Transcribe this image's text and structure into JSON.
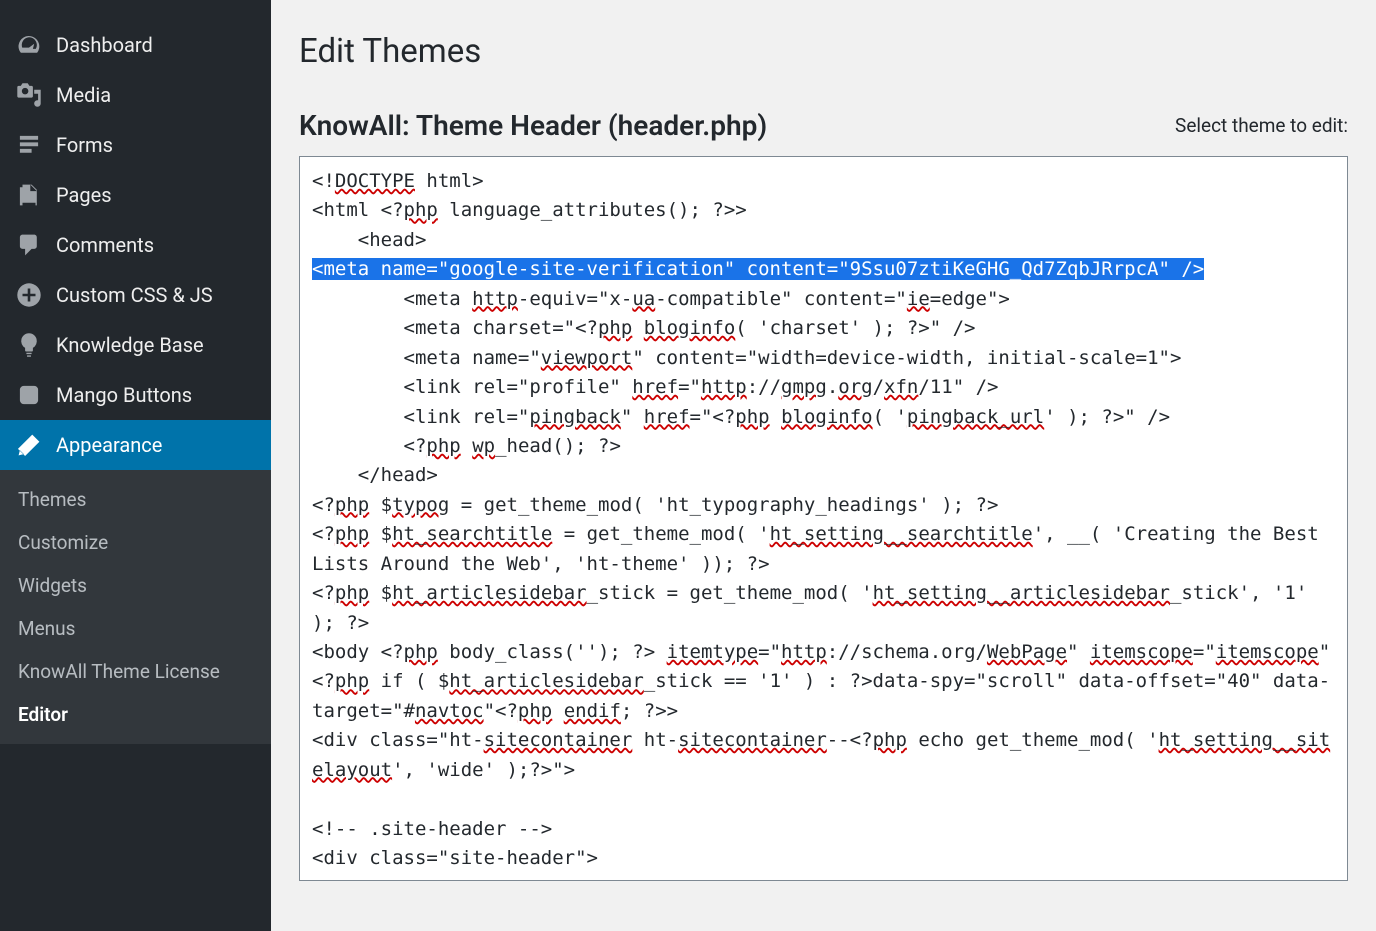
{
  "sidebar": [
    {
      "label": "Dashboard",
      "icon": "dashboard",
      "key": "dashboard"
    },
    {
      "label": "Media",
      "icon": "media",
      "key": "media"
    },
    {
      "label": "Forms",
      "icon": "forms",
      "key": "forms"
    },
    {
      "label": "Pages",
      "icon": "pages",
      "key": "pages"
    },
    {
      "label": "Comments",
      "icon": "comments",
      "key": "comments"
    },
    {
      "label": "Custom CSS & JS",
      "icon": "plus-circle",
      "key": "customcss"
    },
    {
      "label": "Knowledge Base",
      "icon": "lightbulb",
      "key": "kb"
    },
    {
      "label": "Mango Buttons",
      "icon": "mango",
      "key": "mango"
    },
    {
      "label": "Appearance",
      "icon": "brush",
      "key": "appearance",
      "active": true
    }
  ],
  "submenu": [
    {
      "label": "Themes",
      "key": "themes"
    },
    {
      "label": "Customize",
      "key": "customize"
    },
    {
      "label": "Widgets",
      "key": "widgets"
    },
    {
      "label": "Menus",
      "key": "menus"
    },
    {
      "label": "KnowAll Theme License",
      "key": "license"
    },
    {
      "label": "Editor",
      "key": "editor",
      "current": true
    }
  ],
  "page": {
    "title": "Edit Themes",
    "file_heading": "KnowAll: Theme Header (header.php)",
    "select_label": "Select theme to edit:"
  },
  "code": {
    "l1_a": "<!",
    "l1_b": "DOCTYPE",
    "l1_c": " html>",
    "l2_a": "<html <?",
    "l2_b": "php",
    "l2_c": " language_attributes(); ?>>",
    "l3": "    <head>",
    "l4": "<meta name=\"google-site-verification\" content=\"9Ssu07ztiKeGHG_Qd7ZqbJRrpcA\" />",
    "l5_a": "        <meta ",
    "l5_b": "http",
    "l5_c": "-equiv=\"x-",
    "l5_d": "ua",
    "l5_e": "-compatible\" content=\"",
    "l5_f": "ie",
    "l5_g": "=edge\">",
    "l6_a": "        <meta charset=\"<?",
    "l6_b": "php",
    "l6_c": " ",
    "l6_d": "bloginfo",
    "l6_e": "( 'charset' ); ?>\" />",
    "l7_a": "        <meta name=\"",
    "l7_b": "viewport",
    "l7_c": "\" content=\"width=device-width, initial-scale=1\">",
    "l8_a": "        <link rel=\"profile\" ",
    "l8_b": "href",
    "l8_c": "=\"",
    "l8_d": "http",
    "l8_e": "://",
    "l8_f": "gmpg",
    "l8_g": ".",
    "l8_h": "org",
    "l8_i": "/",
    "l8_j": "xfn",
    "l8_k": "/11\" />",
    "l9_a": "        <link rel=\"",
    "l9_b": "pingback",
    "l9_c": "\" ",
    "l9_d": "href",
    "l9_e": "=\"<?",
    "l9_f": "php",
    "l9_g": " ",
    "l9_h": "bloginfo",
    "l9_i": "( '",
    "l9_j": "pingback_url",
    "l9_k": "' ); ?>\" />",
    "l10_a": "        <?",
    "l10_b": "php",
    "l10_c": " ",
    "l10_d": "wp",
    "l10_e": "_head(); ?>",
    "l11": "    </head>",
    "l12_a": "<?",
    "l12_b": "php",
    "l12_c": " $",
    "l12_d": "typog",
    "l12_e": " = get_theme_mod( 'ht_typography_headings' ); ?>",
    "l13_a": "<?",
    "l13_b": "php",
    "l13_c": " $",
    "l13_d": "ht_searchtitle",
    "l13_e": " = get_theme_mod( '",
    "l13_f": "ht_setting__searchtitle",
    "l13_g": "', __( 'Creating the Best Lists Around the Web', 'ht-theme' )); ?>",
    "l14_a": "<?",
    "l14_b": "php",
    "l14_c": " $",
    "l14_d": "ht_articlesidebar",
    "l14_e": "_stick = get_theme_mod( '",
    "l14_f": "ht_setting__articlesidebar",
    "l14_g": "_stick', '1' ); ?>",
    "l15_a": "<body <?",
    "l15_b": "php",
    "l15_c": " body_class(''); ?> ",
    "l15_d": "itemtype",
    "l15_e": "=\"",
    "l15_f": "http",
    "l15_g": "://schema.org/",
    "l15_h": "WebPage",
    "l15_i": "\" ",
    "l15_j": "itemscope",
    "l15_k": "=\"",
    "l15_l": "itemscope",
    "l15_m": "\" <?",
    "l15_n": "php",
    "l15_o": " if ( $",
    "l15_p": "ht_articlesidebar",
    "l15_q": "_stick == '1' ) : ?>data-spy=\"scroll\" data-offset=\"40\" data-target=\"#",
    "l15_r": "navtoc",
    "l15_s": "\"<?",
    "l15_t": "php",
    "l15_u": " ",
    "l15_v": "endif",
    "l15_w": "; ?>>",
    "l16_a": "<div class=\"ht-",
    "l16_b": "sitecontainer",
    "l16_c": " ht-",
    "l16_d": "sitecontainer",
    "l16_e": "--<?",
    "l16_f": "php",
    "l16_g": " echo get_theme_mod( '",
    "l16_h": "ht_setting__sitelayout",
    "l16_i": "', 'wide' );?>\">",
    "l17": "",
    "l18": "<!-- .site-header -->",
    "l19": "<div class=\"site-header\">"
  }
}
